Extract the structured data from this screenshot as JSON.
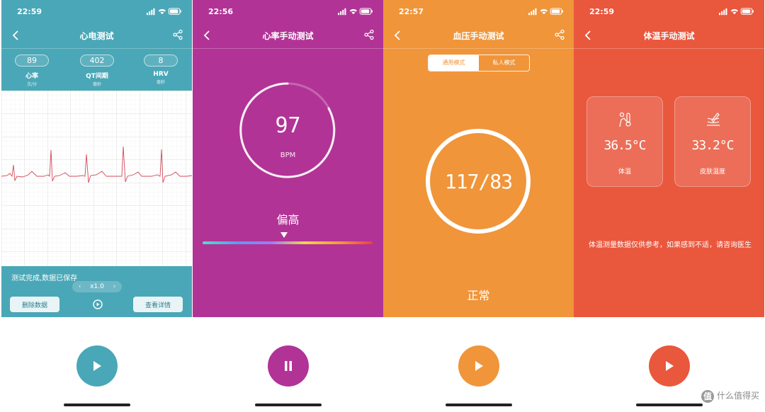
{
  "screens": [
    {
      "time": "22:59",
      "title": "心电测试",
      "metrics": [
        {
          "value": "89",
          "label": "心率",
          "unit": "次/分"
        },
        {
          "value": "402",
          "label": "QT间期",
          "unit": "毫秒"
        },
        {
          "value": "8",
          "label": "HRV",
          "unit": "毫秒"
        }
      ],
      "message": "测试完成,数据已保存",
      "speed": "x1.0",
      "delete_label": "删除数据",
      "detail_label": "查看详情",
      "accent": "#4aa7b7"
    },
    {
      "time": "22:56",
      "title": "心率手动测试",
      "value": "97",
      "unit": "BPM",
      "status": "偏高",
      "accent": "#b23396"
    },
    {
      "time": "22:57",
      "title": "血压手动测试",
      "modes": [
        "通用模式",
        "私人模式"
      ],
      "value": "117/83",
      "status": "正常",
      "accent": "#f0953a"
    },
    {
      "time": "22:59",
      "title": "体温手动测试",
      "cards": [
        {
          "value": "36.5°C",
          "label": "体温",
          "icon": "thermometer-body-icon"
        },
        {
          "value": "33.2°C",
          "label": "皮肤温度",
          "icon": "thermometer-skin-icon"
        }
      ],
      "note": "体温测量数据仅供参考，如果感到不适，请咨询医生",
      "accent": "#e9573d"
    }
  ],
  "controls": [
    {
      "state": "play",
      "icon": "play-icon",
      "color": "#4aa7b7"
    },
    {
      "state": "pause",
      "icon": "pause-icon",
      "color": "#b23396"
    },
    {
      "state": "play",
      "icon": "play-icon",
      "color": "#f0953a"
    },
    {
      "state": "play",
      "icon": "play-icon",
      "color": "#e9573d"
    }
  ],
  "watermark": {
    "logo": "值",
    "text": "什么值得买"
  }
}
